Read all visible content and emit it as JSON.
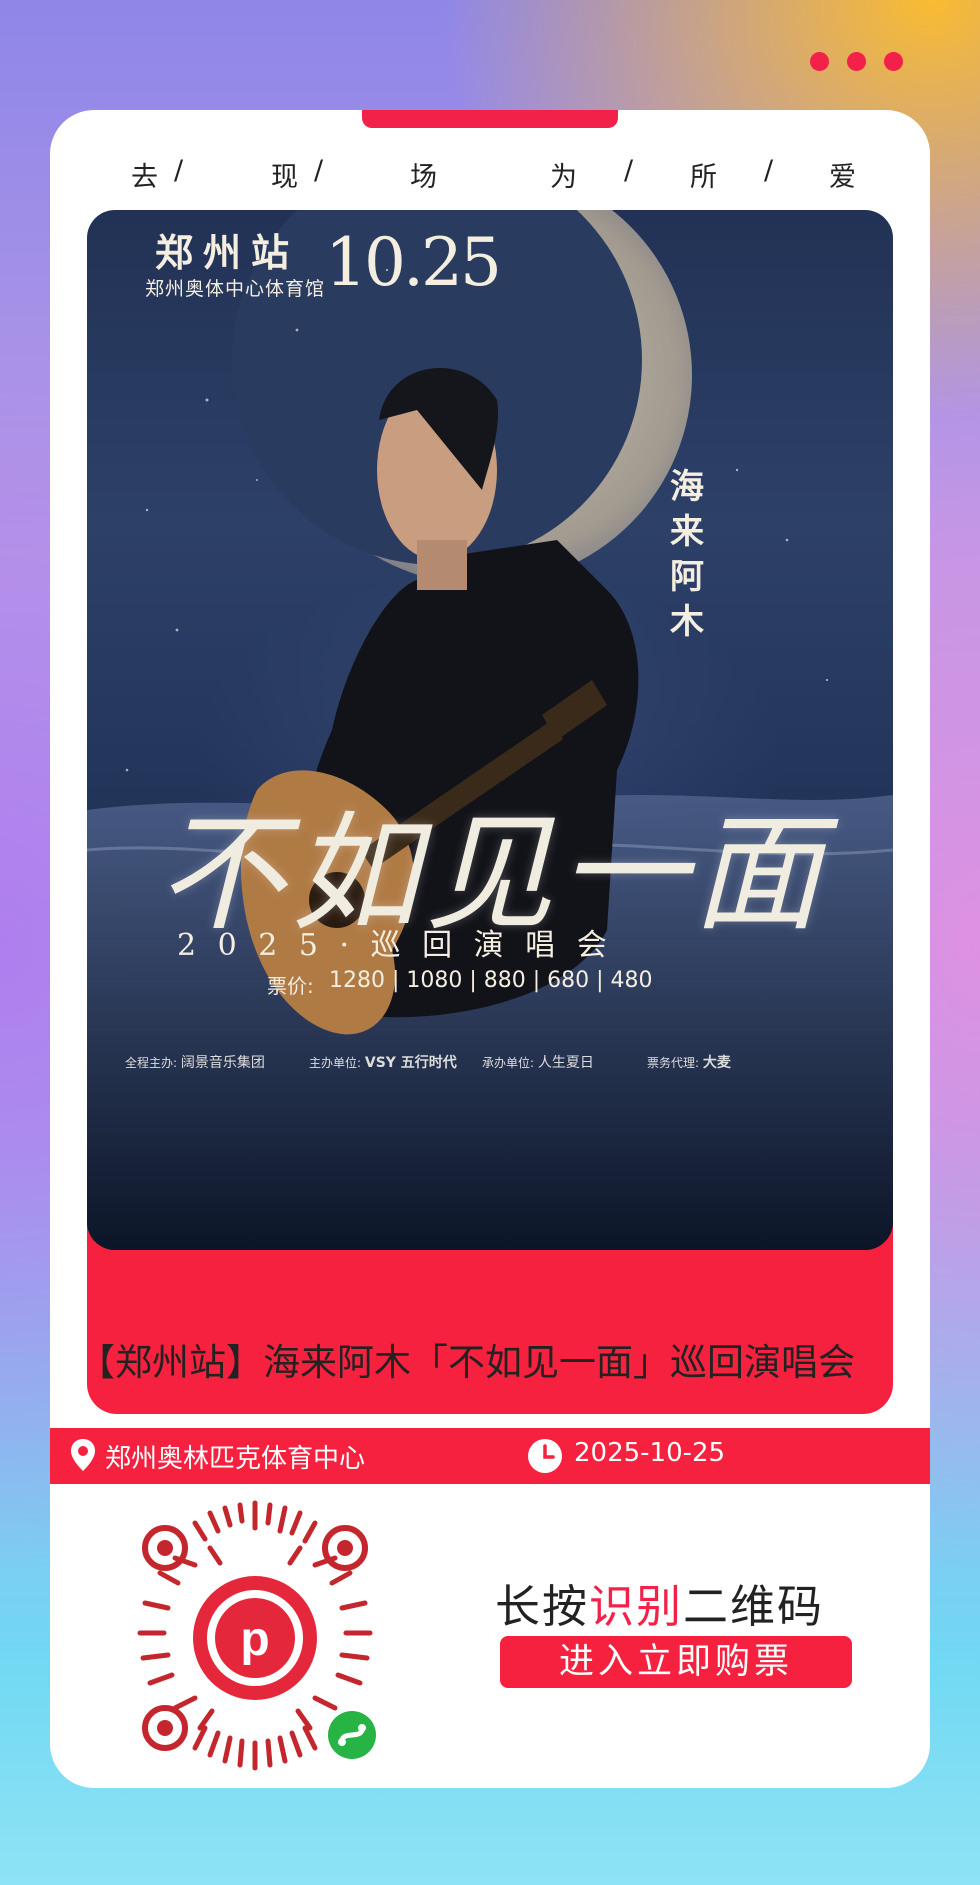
{
  "slogan": [
    "去",
    "/",
    "现",
    "/",
    "场",
    "为",
    "/",
    "所",
    "/",
    "爱"
  ],
  "poster": {
    "station": "郑州站",
    "date": "10.25",
    "venue": "郑州奥体中心体育馆",
    "artist_vertical": [
      "海",
      "来",
      "阿",
      "木"
    ],
    "show_title": "不如见一面",
    "tour_line": "2 0 2 5 · 巡 回 演 唱 会",
    "price_label": "票价:",
    "prices": "1280 | 1080 | 880 | 680 | 480",
    "sponsor_1_label": "全程主办:",
    "sponsor_1_name": "阔景音乐集团",
    "sponsor_2_label": "主办单位:",
    "sponsor_2_name": "VSY 五行时代",
    "sponsor_3_label": "承办单位:",
    "sponsor_3_name": "人生夏日",
    "sponsor_4_label": "票务代理:",
    "sponsor_4_name": "大麦"
  },
  "event_title": "【郑州站】海来阿木「不如见一面」巡回演唱会",
  "info": {
    "location": "郑州奥林匹克体育中心",
    "date": "2025-10-25"
  },
  "cta": {
    "line1_a": "长按",
    "line1_b": "识别",
    "line1_c": "二维码",
    "line2": "进入立即购票"
  },
  "colors": {
    "accent": "#f2214a",
    "poster_bg": "#223255"
  },
  "icons": [
    "more-dots-icon",
    "location-pin-icon",
    "clock-icon",
    "qr-code-icon",
    "mini-program-icon"
  ]
}
